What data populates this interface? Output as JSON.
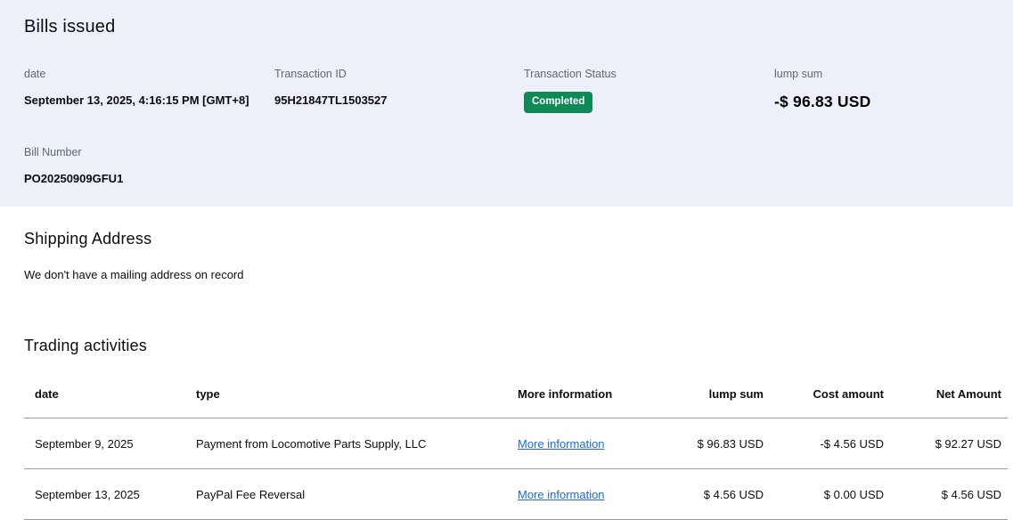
{
  "page": {
    "title": "Bills issued"
  },
  "summary": {
    "fields": [
      {
        "label": "date",
        "value": "September 13, 2025, 4:16:15 PM [GMT+8]"
      },
      {
        "label": "Transaction ID",
        "value": "95H21847TL1503527"
      },
      {
        "label": "Transaction Status",
        "value": "Completed"
      },
      {
        "label": "lump sum",
        "value": "-$ 96.83 USD"
      }
    ],
    "bill_number": {
      "label": "Bill Number",
      "value": "PO20250909GFU1"
    }
  },
  "shipping": {
    "title": "Shipping Address",
    "message": "We don't have a mailing address on record"
  },
  "trading": {
    "title": "Trading activities",
    "table": {
      "columns": [
        "date",
        "type",
        "More information",
        "lump sum",
        "Cost amount",
        "Net Amount"
      ],
      "rows": [
        {
          "date": "September 9, 2025",
          "type": "Payment from Locomotive Parts Supply, LLC",
          "more_info": "More information",
          "lump_sum": "$ 96.83 USD",
          "cost_amount": "-$ 4.56 USD",
          "net_amount": "$ 92.27 USD"
        },
        {
          "date": "September 13, 2025",
          "type": "PayPal Fee Reversal",
          "more_info": "More information",
          "lump_sum": "$ 4.56 USD",
          "cost_amount": "$ 0.00 USD",
          "net_amount": "$ 4.56 USD"
        }
      ]
    }
  },
  "colors": {
    "header_bg": "#eef0f9",
    "badge_bg": "#0d8a56",
    "link": "#1a6be0",
    "label_gray": "#5e6873"
  }
}
